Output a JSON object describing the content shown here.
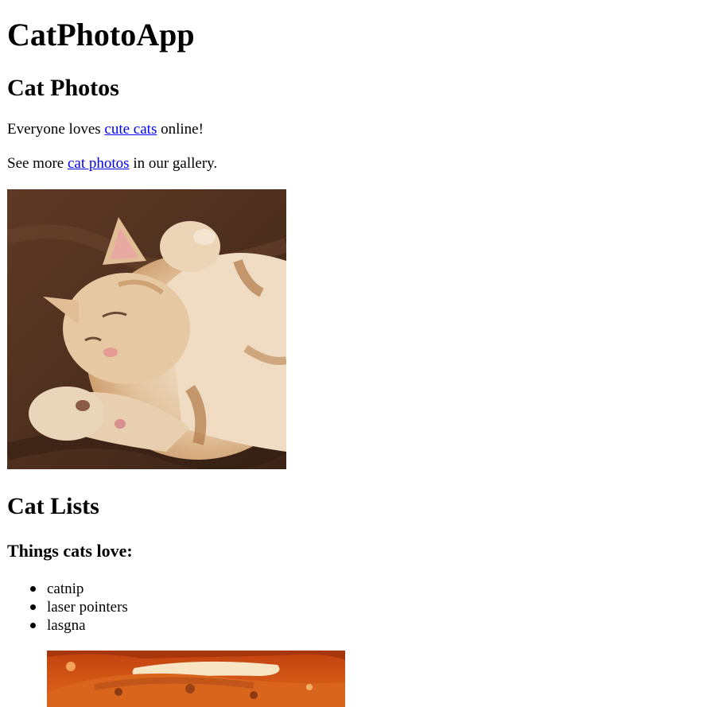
{
  "app": {
    "title": "CatPhotoApp"
  },
  "photos_section": {
    "heading": "Cat Photos",
    "intro_before": "Everyone loves ",
    "intro_link": "cute cats",
    "intro_after": " online!",
    "more_before": "See more ",
    "more_link": "cat photos",
    "more_after": " in our gallery.",
    "photo_subject": "orange tabby cat sleeping on a brown blanket"
  },
  "lists_section": {
    "heading": "Cat Lists",
    "subheading": "Things cats love:",
    "items": [
      "catnip",
      "laser pointers",
      "lasgna"
    ],
    "photo_subject": "lasagna"
  },
  "colors": {
    "link": "#0000ee",
    "text": "#000000",
    "background": "#ffffff"
  }
}
